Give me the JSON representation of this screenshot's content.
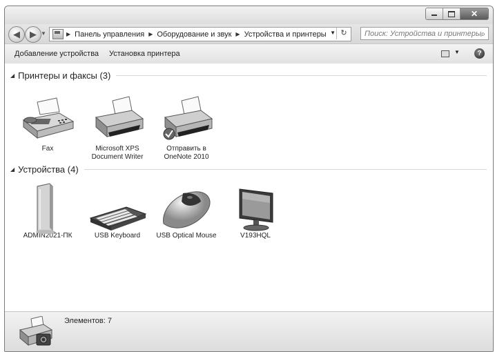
{
  "window": {
    "buttons": {
      "minimize": "–",
      "maximize": "□",
      "close": "✕"
    }
  },
  "navigation": {
    "back_icon": "◀",
    "forward_icon": "▶",
    "breadcrumbs": [
      "Панель управления",
      "Оборудование и звук",
      "Устройства и принтеры"
    ],
    "refresh_icon": "↻",
    "search_placeholder": "Поиск: Устройства и принтеры"
  },
  "toolbar": {
    "add_device": "Добавление устройства",
    "add_printer": "Установка принтера",
    "help_icon": "?"
  },
  "groups": [
    {
      "title": "Принтеры и факсы (3)",
      "items": [
        {
          "label": "Fax",
          "icon": "fax-icon"
        },
        {
          "label": "Microsoft XPS Document Writer",
          "icon": "printer-icon"
        },
        {
          "label": "Отправить в OneNote 2010",
          "icon": "printer-default-icon",
          "default": true
        }
      ]
    },
    {
      "title": "Устройства (4)",
      "items": [
        {
          "label": "ADMIN2021-ПК",
          "icon": "computer-icon"
        },
        {
          "label": "USB Keyboard",
          "icon": "keyboard-icon"
        },
        {
          "label": "USB Optical Mouse",
          "icon": "mouse-icon"
        },
        {
          "label": "V193HQL",
          "icon": "monitor-icon"
        }
      ]
    }
  ],
  "status": {
    "text": "Элементов: 7",
    "icon": "devices-printers-icon"
  }
}
